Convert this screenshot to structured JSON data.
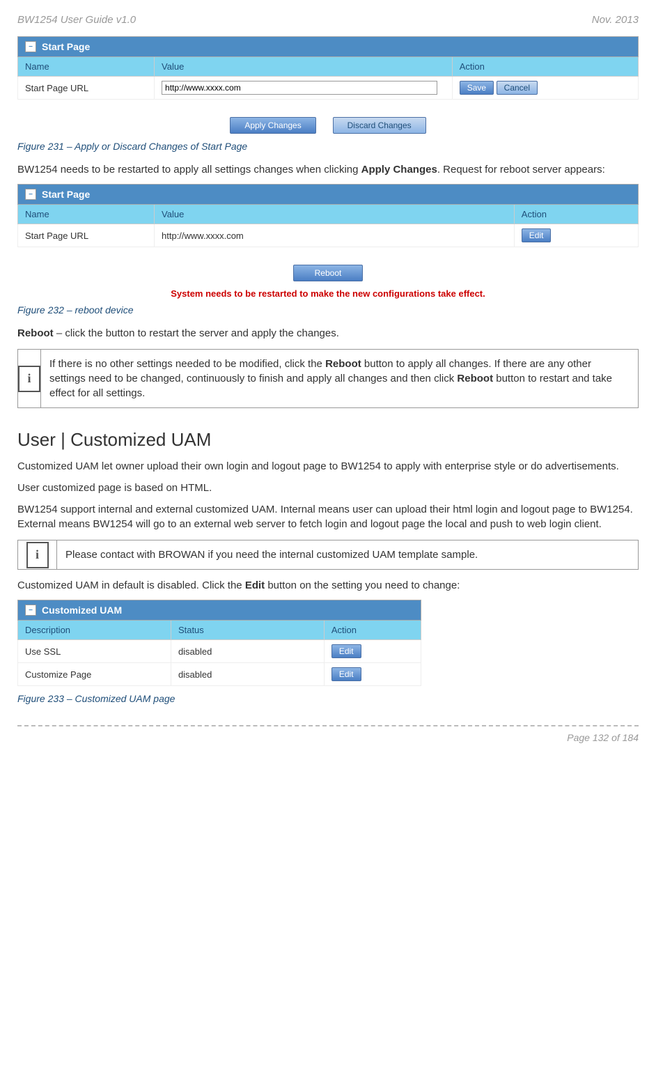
{
  "page_header": {
    "left": "BW1254 User Guide v1.0",
    "right": "Nov.  2013"
  },
  "fig231": {
    "title": "Start Page",
    "columns": {
      "name": "Name",
      "value": "Value",
      "action": "Action"
    },
    "row": {
      "name": "Start Page URL",
      "value": "http://www.xxxx.com",
      "save": "Save",
      "cancel": "Cancel"
    },
    "apply": "Apply Changes",
    "discard": "Discard Changes",
    "caption": "Figure 231 – Apply or Discard Changes of Start Page"
  },
  "para_apply": {
    "pre": "BW1254 needs to be restarted to apply all settings changes when clicking ",
    "bold": "Apply Changes",
    "post": ". Request for reboot server appears:"
  },
  "fig232": {
    "title": "Start Page",
    "columns": {
      "name": "Name",
      "value": "Value",
      "action": "Action"
    },
    "row": {
      "name": "Start Page URL",
      "value": "http://www.xxxx.com",
      "edit": "Edit"
    },
    "reboot": "Reboot",
    "notice": "System needs to be restarted to make the new configurations take effect.",
    "caption": "Figure 232 – reboot device"
  },
  "para_reboot": {
    "bold": "Reboot",
    "post": " – click the button to restart the server and apply the changes."
  },
  "info1": {
    "pre": "If there is no other settings needed to be modified, click the ",
    "b1": "Reboot",
    "mid": " button to apply all changes. If there are any other settings need to be changed, continuously to finish and apply all changes and then click ",
    "b2": "Reboot",
    "post": " button to restart and take effect  for all settings."
  },
  "section_heading": "User | Customized UAM",
  "para_uam1": "Customized UAM let owner upload their own login and logout page to BW1254 to apply with enterprise style or do advertisements.",
  "para_uam2": "User customized page is based on HTML.",
  "para_uam3": "BW1254 support internal and external customized UAM. Internal means user can upload their html login and logout page to BW1254. External means BW1254 will go to an external web server to fetch login and logout page the local and push to web login client.",
  "info2": "Please contact with BROWAN if you need the internal customized UAM template sample.",
  "para_edit": {
    "pre": "Customized UAM in default is disabled.  Click the ",
    "bold": "Edit",
    "post": " button on the setting you need to change:"
  },
  "fig233": {
    "title": "Customized UAM",
    "columns": {
      "desc": "Description",
      "status": "Status",
      "action": "Action"
    },
    "rows": [
      {
        "desc": "Use SSL",
        "status": "disabled",
        "action": "Edit"
      },
      {
        "desc": "Customize Page",
        "status": "disabled",
        "action": "Edit"
      }
    ],
    "caption": "Figure 233 – Customized UAM page"
  },
  "footer": "Page 132 of 184",
  "chart_data": {
    "type": "table",
    "title": "Customized UAM",
    "columns": [
      "Description",
      "Status",
      "Action"
    ],
    "rows": [
      [
        "Use SSL",
        "disabled",
        "Edit"
      ],
      [
        "Customize Page",
        "disabled",
        "Edit"
      ]
    ]
  }
}
